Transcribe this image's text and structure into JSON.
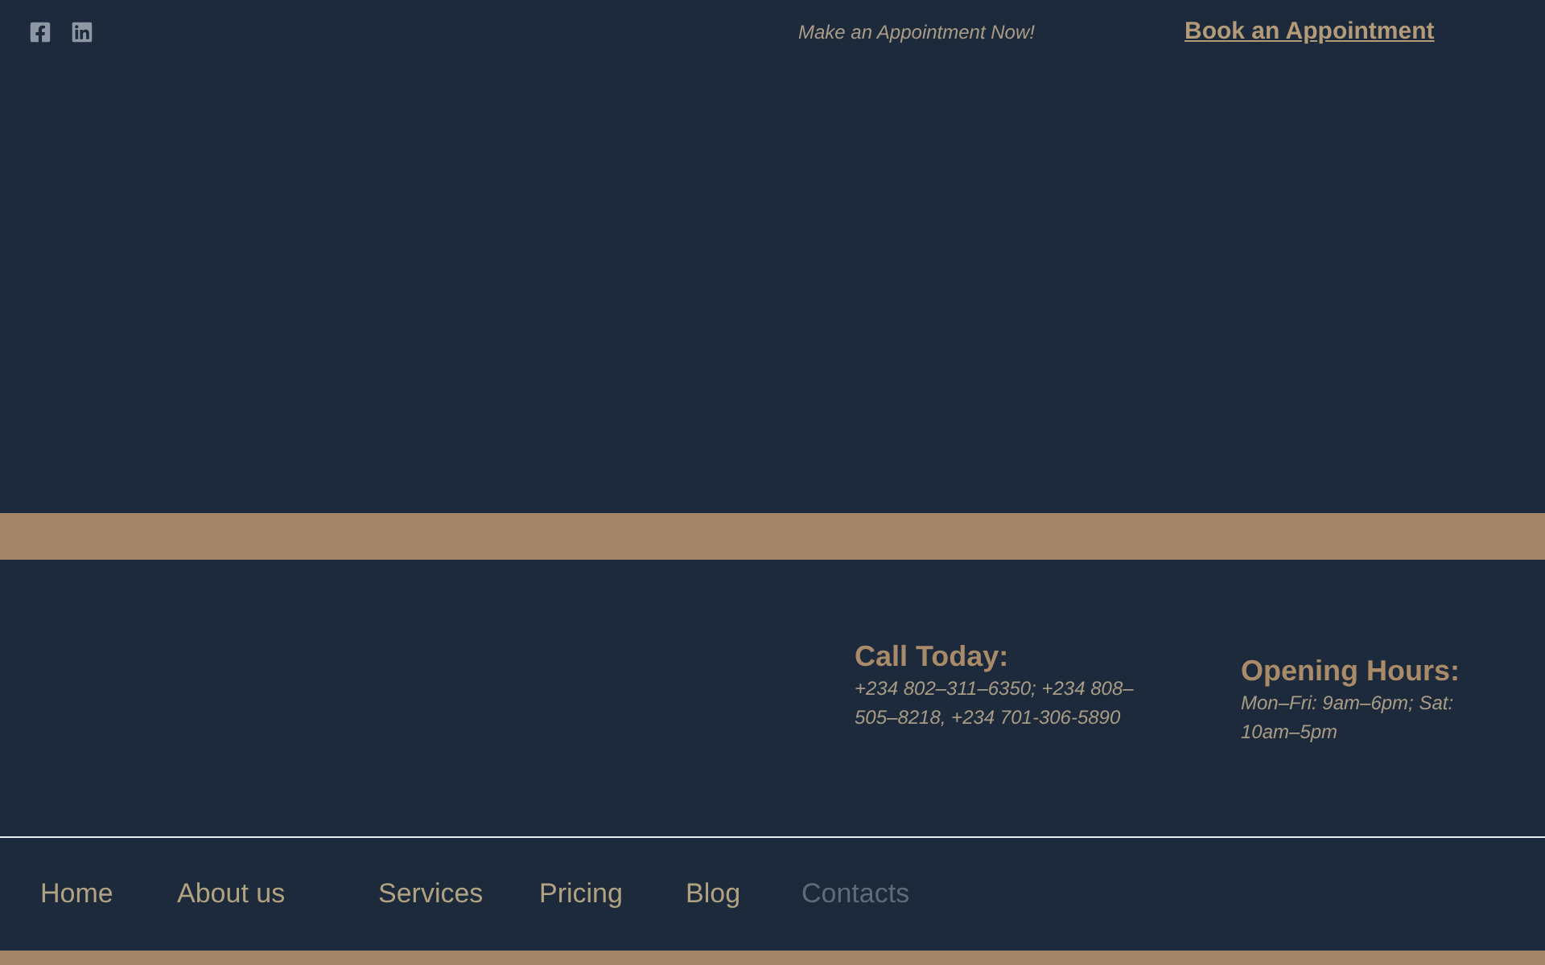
{
  "top_bar": {
    "tagline": "Make an Appointment Now!",
    "cta_link": "Book an Appointment"
  },
  "contact": {
    "call": {
      "heading": "Call Today:",
      "text": "+234 802–311–6350; +234 808–505–8218, +234 701-306-5890"
    },
    "hours": {
      "heading": "Opening Hours:",
      "text": "Mon–Fri: 9am–6pm; Sat: 10am–5pm"
    }
  },
  "nav": {
    "items": [
      {
        "label": "Home",
        "selected": false
      },
      {
        "label": "About us",
        "selected": false
      },
      {
        "label": "Services",
        "selected": false
      },
      {
        "label": "Pricing",
        "selected": false
      },
      {
        "label": "Blog",
        "selected": false
      },
      {
        "label": "Contacts",
        "selected": true
      }
    ]
  }
}
